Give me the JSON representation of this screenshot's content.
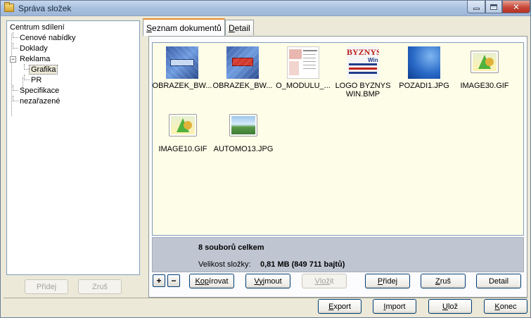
{
  "window": {
    "title": "Správa složek",
    "controls": {
      "minimize": "minimize-button",
      "maximize": "maximize-button",
      "close": "close-button"
    }
  },
  "tree": {
    "root": "Centrum sdílení",
    "items": [
      {
        "label": "Cenové nabídky"
      },
      {
        "label": "Doklady"
      },
      {
        "label": "Reklama",
        "expander": "−"
      },
      {
        "label": "Grafika"
      },
      {
        "label": "PR"
      },
      {
        "label": "Specifikace"
      },
      {
        "label": "nezařazené"
      }
    ]
  },
  "left_buttons": {
    "add": "Přidej",
    "remove": "Zruš"
  },
  "tabs": [
    {
      "label_u": "S",
      "label_rest": "eznam dokumentů",
      "active": true
    },
    {
      "label_u": "D",
      "label_rest": "etail",
      "active": false
    }
  ],
  "files": [
    {
      "name": "OBRAZEK_BW...",
      "icon": "photo-thumbnail-icon"
    },
    {
      "name": "OBRAZEK_BW...",
      "icon": "photo-thumbnail-icon"
    },
    {
      "name": "O_MODULU_...",
      "icon": "document-thumbnail-icon"
    },
    {
      "name": "LOGO BYZNYS WIN.BMP",
      "icon": "logo-thumbnail-icon",
      "logo_text": "BYZNYS",
      "logo_sub": "Win"
    },
    {
      "name": "POZADI1.JPG",
      "icon": "background-thumbnail-icon"
    },
    {
      "name": "IMAGE30.GIF",
      "icon": "image-file-icon"
    },
    {
      "name": "IMAGE10.GIF",
      "icon": "image-file-icon"
    },
    {
      "name": "AUTOMO13.JPG",
      "icon": "landscape-image-icon"
    }
  ],
  "info": {
    "count": "8 souborů celkem",
    "size_label": "Velikost složky:",
    "size_value": "0,81 MB (849 711 bajtů)"
  },
  "toolbar": {
    "plus": "+",
    "minus": "−",
    "copy_u": "Kop",
    "copy_rest": "írovat",
    "cut_u": "Vyj",
    "cut_rest": "mout",
    "paste_u": "Vlož",
    "paste_rest": "it",
    "add_u": "P",
    "add_rest": "řidej",
    "remove_u": "Z",
    "remove_rest": "ruš",
    "detail": "Detail"
  },
  "footer": {
    "export_u": "E",
    "export_rest": "xport",
    "import_u": "I",
    "import_rest": "mport",
    "save_u": "U",
    "save_rest": "lož",
    "close_u": "K",
    "close_rest": "onec"
  }
}
